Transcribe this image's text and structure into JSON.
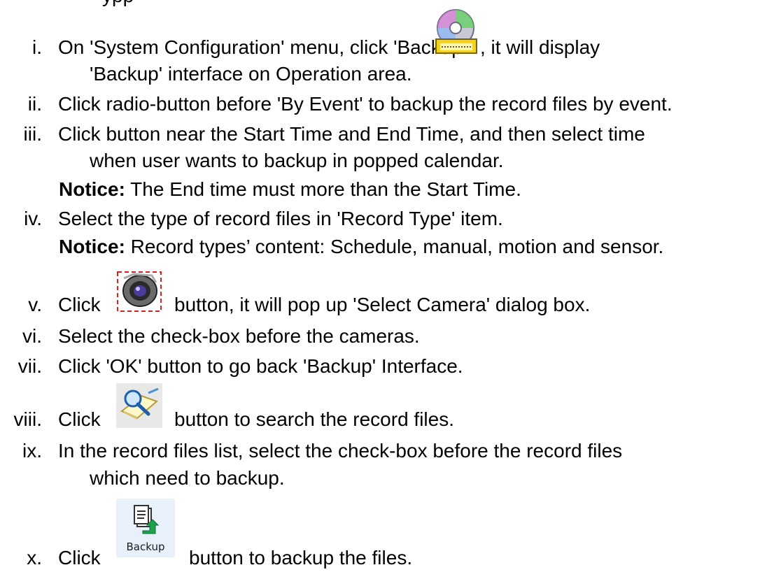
{
  "top_fragment": "ypp",
  "steps": [
    {
      "id": "i",
      "num": "i.",
      "pre": "On 'System Configuration' menu, click 'Backup'",
      "post": ", it will display",
      "cont": "'Backup' interface on Operation area.",
      "icon": "backup-disc-icon"
    },
    {
      "id": "ii",
      "num": "ii.",
      "text": "Click radio-button before 'By Event' to backup the record files by event."
    },
    {
      "id": "iii",
      "num": "iii.",
      "text": "Click button near the Start Time and End Time, and then select time",
      "cont": "when user wants to backup in popped calendar."
    },
    {
      "id": "notice1",
      "label": "Notice:",
      "text": " The End time must more than the Start Time."
    },
    {
      "id": "iv",
      "num": "iv.",
      "text": "Select the type of record files in 'Record Type' item."
    },
    {
      "id": "notice2",
      "label": "Notice:",
      "text": " Record types’ content: Schedule, manual, motion and sensor."
    },
    {
      "id": "v",
      "num": "v.",
      "pre": "Click",
      "post": "button, it will pop up 'Select Camera' dialog box.",
      "icon": "camera-icon"
    },
    {
      "id": "vi",
      "num": "vi.",
      "text": "Select the check-box before the cameras."
    },
    {
      "id": "vii",
      "num": "vii.",
      "text": "Click 'OK' button to go back 'Backup' Interface."
    },
    {
      "id": "viii",
      "num": "viii.",
      "pre": "Click",
      "post": "button to search the record files.",
      "icon": "search-icon"
    },
    {
      "id": "ix",
      "num": "ix.",
      "text": "In the record files list, select the check-box before the record files",
      "cont": "which need to backup."
    },
    {
      "id": "x",
      "num": "x.",
      "pre": "Click",
      "post": "button to backup the files.",
      "icon": "backup-button-icon",
      "icon_label": "Backup"
    }
  ]
}
